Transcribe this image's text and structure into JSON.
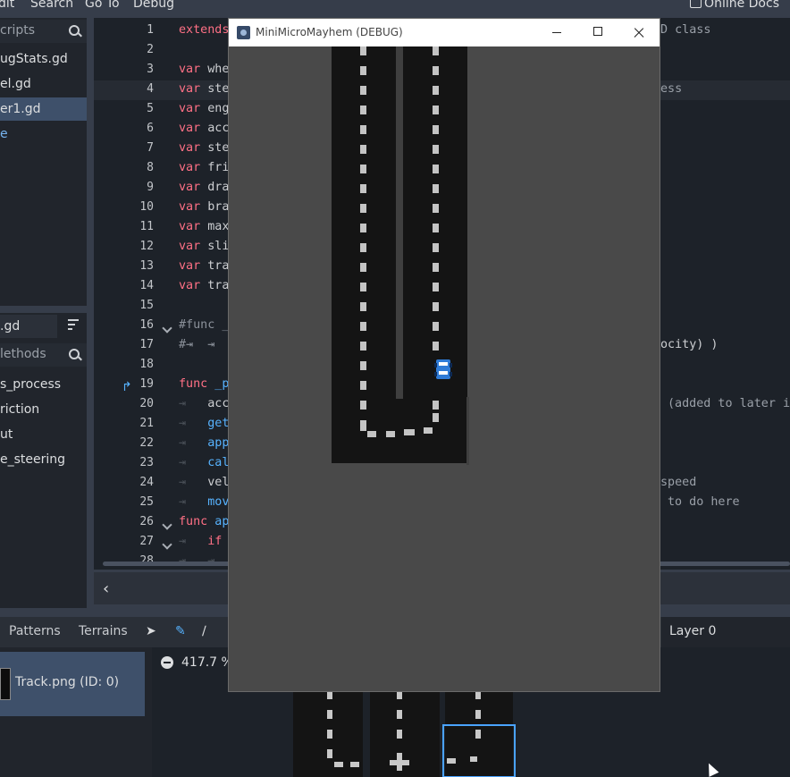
{
  "menubar": {
    "items": [
      "dit",
      "Search",
      "Go To",
      "Debug"
    ],
    "online_docs": "Online Docs"
  },
  "scripts_panel": {
    "filter_placeholder": "cripts",
    "items": [
      {
        "label": "ugStats.gd",
        "selected": false
      },
      {
        "label": "el.gd",
        "selected": false
      },
      {
        "label": "er1.gd",
        "selected": true
      },
      {
        "label": "e",
        "selected": false
      }
    ],
    "current_file": ".gd",
    "methods_filter_placeholder": "lethods",
    "methods": [
      "s_process",
      "riction",
      "ut",
      "e_steering"
    ]
  },
  "editor": {
    "line_numbers": [
      "1",
      "2",
      "3",
      "4",
      "5",
      "6",
      "7",
      "8",
      "9",
      "10",
      "11",
      "12",
      "13",
      "14",
      "15",
      "16",
      "17",
      "18",
      "19",
      "20",
      "21",
      "22",
      "23",
      "24",
      "25",
      "26",
      "27",
      "28"
    ],
    "lines": [
      [
        [
          "kw",
          "extends"
        ]
      ],
      [],
      [
        [
          "kw",
          "var"
        ],
        [
          "txt",
          " whe"
        ]
      ],
      [
        [
          "kw",
          "var"
        ],
        [
          "txt",
          " ste"
        ]
      ],
      [
        [
          "kw",
          "var"
        ],
        [
          "txt",
          " eng"
        ]
      ],
      [
        [
          "kw",
          "var"
        ],
        [
          "txt",
          " acc"
        ]
      ],
      [
        [
          "kw",
          "var"
        ],
        [
          "txt",
          " ste"
        ]
      ],
      [
        [
          "kw",
          "var"
        ],
        [
          "txt",
          " fri"
        ]
      ],
      [
        [
          "kw",
          "var"
        ],
        [
          "txt",
          " dra"
        ]
      ],
      [
        [
          "kw",
          "var"
        ],
        [
          "txt",
          " bra"
        ]
      ],
      [
        [
          "kw",
          "var"
        ],
        [
          "txt",
          " max"
        ]
      ],
      [
        [
          "kw",
          "var"
        ],
        [
          "txt",
          " sli"
        ]
      ],
      [
        [
          "kw",
          "var"
        ],
        [
          "txt",
          " tra"
        ]
      ],
      [
        [
          "kw",
          "var"
        ],
        [
          "txt",
          " tra"
        ]
      ],
      [],
      [
        [
          "cm",
          "#func _"
        ]
      ],
      [
        [
          "cm",
          "#⇥  ⇥"
        ]
      ],
      [],
      [
        [
          "kw",
          "func"
        ],
        [
          "fn",
          " _p"
        ]
      ],
      [
        [
          "tab",
          "⇥   "
        ],
        [
          "txt",
          "acc"
        ]
      ],
      [
        [
          "tab",
          "⇥   "
        ],
        [
          "fn",
          "get"
        ]
      ],
      [
        [
          "tab",
          "⇥   "
        ],
        [
          "fn",
          "app"
        ]
      ],
      [
        [
          "tab",
          "⇥   "
        ],
        [
          "fn",
          "cal"
        ]
      ],
      [
        [
          "tab",
          "⇥   "
        ],
        [
          "txt",
          "vel"
        ]
      ],
      [
        [
          "tab",
          "⇥   "
        ],
        [
          "fn",
          "mov"
        ]
      ],
      [
        [
          "kw",
          "func"
        ],
        [
          "fn",
          " ap"
        ]
      ],
      [
        [
          "tab",
          "⇥   "
        ],
        [
          "kw",
          "if"
        ]
      ],
      [
        [
          "tab",
          "⇥   ⇥"
        ]
      ]
    ],
    "overflow_text": {
      "line1": "D class",
      "line4": "ess",
      "line17": "ocity) )",
      "line20": "(added to later i",
      "line24": "speed",
      "line25": "to do here"
    }
  },
  "tileset_panel": {
    "tabs": [
      "Patterns",
      "Terrains"
    ],
    "layer": "Layer 0",
    "tile_source": "Track.png (ID: 0)",
    "zoom": "417.7 %"
  },
  "game_window": {
    "title": "MiniMicroMayhem (DEBUG)"
  },
  "colors": {
    "keyword": "#ff7085",
    "function": "#57b3ff",
    "comment": "#8b919a",
    "selection": "#3e506a",
    "car_blue": "#2f7bd6"
  }
}
